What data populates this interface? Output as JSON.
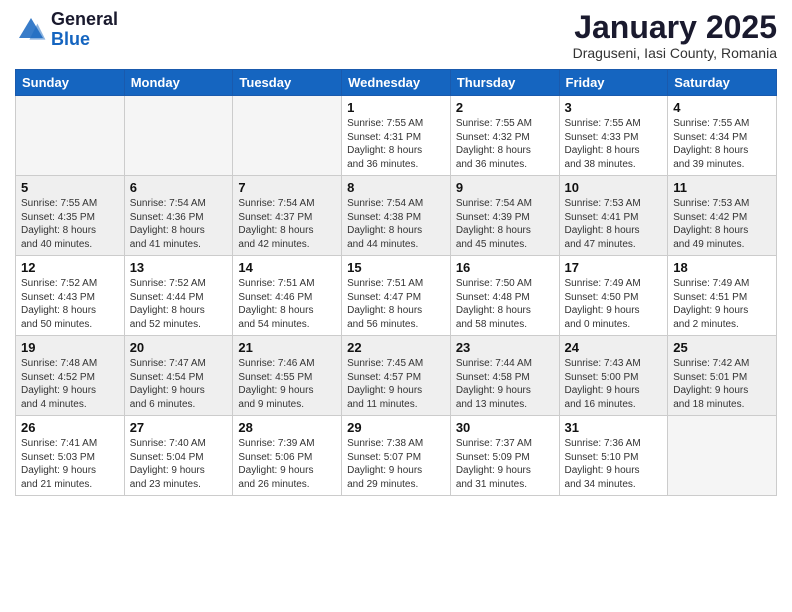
{
  "header": {
    "logo_general": "General",
    "logo_blue": "Blue",
    "month_title": "January 2025",
    "location": "Draguseni, Iasi County, Romania"
  },
  "weekdays": [
    "Sunday",
    "Monday",
    "Tuesday",
    "Wednesday",
    "Thursday",
    "Friday",
    "Saturday"
  ],
  "weeks": [
    [
      {
        "day": "",
        "info": ""
      },
      {
        "day": "",
        "info": ""
      },
      {
        "day": "",
        "info": ""
      },
      {
        "day": "1",
        "info": "Sunrise: 7:55 AM\nSunset: 4:31 PM\nDaylight: 8 hours\nand 36 minutes."
      },
      {
        "day": "2",
        "info": "Sunrise: 7:55 AM\nSunset: 4:32 PM\nDaylight: 8 hours\nand 36 minutes."
      },
      {
        "day": "3",
        "info": "Sunrise: 7:55 AM\nSunset: 4:33 PM\nDaylight: 8 hours\nand 38 minutes."
      },
      {
        "day": "4",
        "info": "Sunrise: 7:55 AM\nSunset: 4:34 PM\nDaylight: 8 hours\nand 39 minutes."
      }
    ],
    [
      {
        "day": "5",
        "info": "Sunrise: 7:55 AM\nSunset: 4:35 PM\nDaylight: 8 hours\nand 40 minutes."
      },
      {
        "day": "6",
        "info": "Sunrise: 7:54 AM\nSunset: 4:36 PM\nDaylight: 8 hours\nand 41 minutes."
      },
      {
        "day": "7",
        "info": "Sunrise: 7:54 AM\nSunset: 4:37 PM\nDaylight: 8 hours\nand 42 minutes."
      },
      {
        "day": "8",
        "info": "Sunrise: 7:54 AM\nSunset: 4:38 PM\nDaylight: 8 hours\nand 44 minutes."
      },
      {
        "day": "9",
        "info": "Sunrise: 7:54 AM\nSunset: 4:39 PM\nDaylight: 8 hours\nand 45 minutes."
      },
      {
        "day": "10",
        "info": "Sunrise: 7:53 AM\nSunset: 4:41 PM\nDaylight: 8 hours\nand 47 minutes."
      },
      {
        "day": "11",
        "info": "Sunrise: 7:53 AM\nSunset: 4:42 PM\nDaylight: 8 hours\nand 49 minutes."
      }
    ],
    [
      {
        "day": "12",
        "info": "Sunrise: 7:52 AM\nSunset: 4:43 PM\nDaylight: 8 hours\nand 50 minutes."
      },
      {
        "day": "13",
        "info": "Sunrise: 7:52 AM\nSunset: 4:44 PM\nDaylight: 8 hours\nand 52 minutes."
      },
      {
        "day": "14",
        "info": "Sunrise: 7:51 AM\nSunset: 4:46 PM\nDaylight: 8 hours\nand 54 minutes."
      },
      {
        "day": "15",
        "info": "Sunrise: 7:51 AM\nSunset: 4:47 PM\nDaylight: 8 hours\nand 56 minutes."
      },
      {
        "day": "16",
        "info": "Sunrise: 7:50 AM\nSunset: 4:48 PM\nDaylight: 8 hours\nand 58 minutes."
      },
      {
        "day": "17",
        "info": "Sunrise: 7:49 AM\nSunset: 4:50 PM\nDaylight: 9 hours\nand 0 minutes."
      },
      {
        "day": "18",
        "info": "Sunrise: 7:49 AM\nSunset: 4:51 PM\nDaylight: 9 hours\nand 2 minutes."
      }
    ],
    [
      {
        "day": "19",
        "info": "Sunrise: 7:48 AM\nSunset: 4:52 PM\nDaylight: 9 hours\nand 4 minutes."
      },
      {
        "day": "20",
        "info": "Sunrise: 7:47 AM\nSunset: 4:54 PM\nDaylight: 9 hours\nand 6 minutes."
      },
      {
        "day": "21",
        "info": "Sunrise: 7:46 AM\nSunset: 4:55 PM\nDaylight: 9 hours\nand 9 minutes."
      },
      {
        "day": "22",
        "info": "Sunrise: 7:45 AM\nSunset: 4:57 PM\nDaylight: 9 hours\nand 11 minutes."
      },
      {
        "day": "23",
        "info": "Sunrise: 7:44 AM\nSunset: 4:58 PM\nDaylight: 9 hours\nand 13 minutes."
      },
      {
        "day": "24",
        "info": "Sunrise: 7:43 AM\nSunset: 5:00 PM\nDaylight: 9 hours\nand 16 minutes."
      },
      {
        "day": "25",
        "info": "Sunrise: 7:42 AM\nSunset: 5:01 PM\nDaylight: 9 hours\nand 18 minutes."
      }
    ],
    [
      {
        "day": "26",
        "info": "Sunrise: 7:41 AM\nSunset: 5:03 PM\nDaylight: 9 hours\nand 21 minutes."
      },
      {
        "day": "27",
        "info": "Sunrise: 7:40 AM\nSunset: 5:04 PM\nDaylight: 9 hours\nand 23 minutes."
      },
      {
        "day": "28",
        "info": "Sunrise: 7:39 AM\nSunset: 5:06 PM\nDaylight: 9 hours\nand 26 minutes."
      },
      {
        "day": "29",
        "info": "Sunrise: 7:38 AM\nSunset: 5:07 PM\nDaylight: 9 hours\nand 29 minutes."
      },
      {
        "day": "30",
        "info": "Sunrise: 7:37 AM\nSunset: 5:09 PM\nDaylight: 9 hours\nand 31 minutes."
      },
      {
        "day": "31",
        "info": "Sunrise: 7:36 AM\nSunset: 5:10 PM\nDaylight: 9 hours\nand 34 minutes."
      },
      {
        "day": "",
        "info": ""
      }
    ]
  ]
}
